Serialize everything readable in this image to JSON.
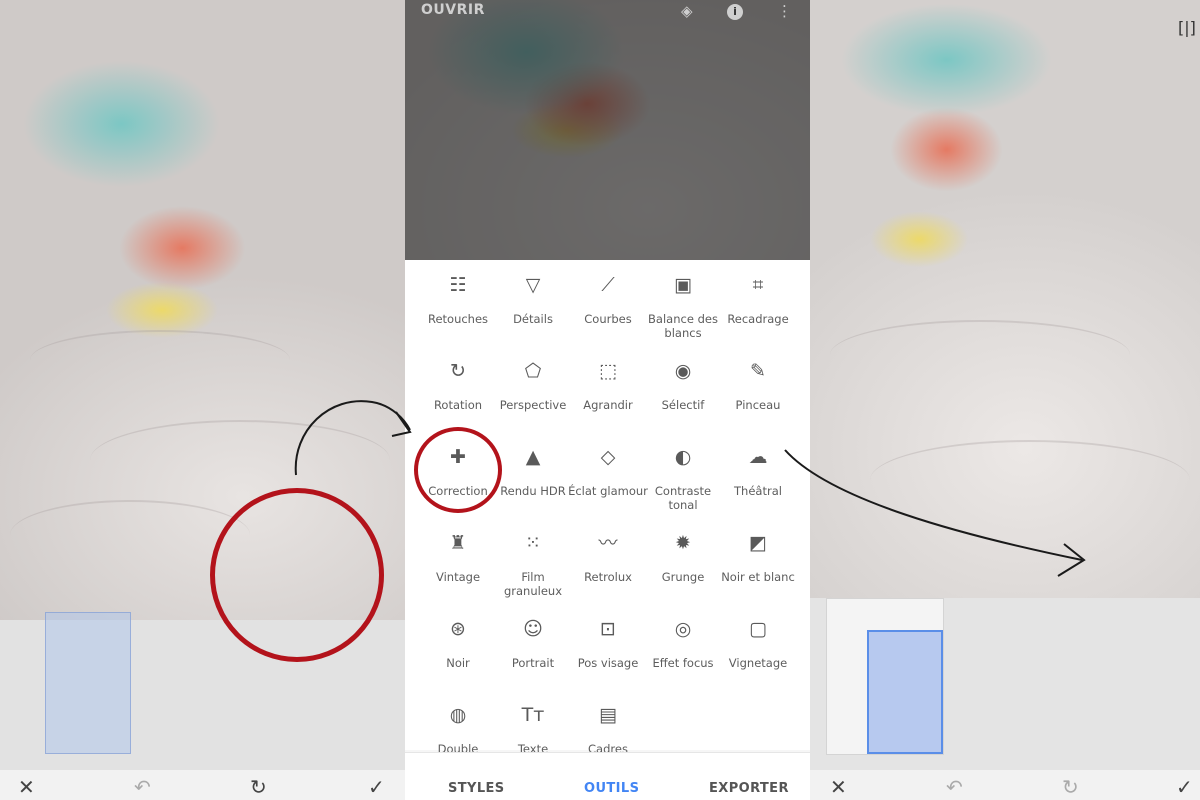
{
  "left_panel": {
    "bottom_bar": {
      "cancel": "✕",
      "undo": "↶",
      "redo": "↻",
      "apply": "✓"
    }
  },
  "editor": {
    "header": {
      "open_label": "OUVRIR",
      "layers_icon": "layers-icon",
      "info_icon": "i",
      "menu_icon": "⋮"
    },
    "tools": [
      {
        "label": "Retouches",
        "icon": "sliders-icon",
        "glyph": "☷"
      },
      {
        "label": "Détails",
        "icon": "triangle-down-icon",
        "glyph": "▽"
      },
      {
        "label": "Courbes",
        "icon": "curves-icon",
        "glyph": "⟋"
      },
      {
        "label": "Balance des blancs",
        "icon": "white-balance-icon",
        "glyph": "▣"
      },
      {
        "label": "Recadrage",
        "icon": "crop-icon",
        "glyph": "⌗"
      },
      {
        "label": "Rotation",
        "icon": "rotate-icon",
        "glyph": "↻"
      },
      {
        "label": "Perspective",
        "icon": "perspective-icon",
        "glyph": "⬠"
      },
      {
        "label": "Agrandir",
        "icon": "expand-icon",
        "glyph": "⬚"
      },
      {
        "label": "Sélectif",
        "icon": "selective-icon",
        "glyph": "◉"
      },
      {
        "label": "Pinceau",
        "icon": "brush-icon",
        "glyph": "✎"
      },
      {
        "label": "Correction",
        "icon": "healing-bandage-icon",
        "glyph": "✚"
      },
      {
        "label": "Rendu HDR",
        "icon": "mountains-icon",
        "glyph": "▲"
      },
      {
        "label": "Éclat glamour",
        "icon": "diamond-icon",
        "glyph": "◇"
      },
      {
        "label": "Contraste tonal",
        "icon": "tonal-contrast-icon",
        "glyph": "◐"
      },
      {
        "label": "Théâtral",
        "icon": "cloud-icon",
        "glyph": "☁"
      },
      {
        "label": "Vintage",
        "icon": "lamp-icon",
        "glyph": "♜"
      },
      {
        "label": "Film granuleux",
        "icon": "grain-icon",
        "glyph": "⁙"
      },
      {
        "label": "Retrolux",
        "icon": "mustache-icon",
        "glyph": "〰"
      },
      {
        "label": "Grunge",
        "icon": "grunge-icon",
        "glyph": "✹"
      },
      {
        "label": "Noir et blanc",
        "icon": "black-white-icon",
        "glyph": "◩"
      },
      {
        "label": "Noir",
        "icon": "film-reel-icon",
        "glyph": "⊛"
      },
      {
        "label": "Portrait",
        "icon": "face-icon",
        "glyph": "☺"
      },
      {
        "label": "Pos visage",
        "icon": "face-frame-icon",
        "glyph": "⊡"
      },
      {
        "label": "Effet focus",
        "icon": "focus-icon",
        "glyph": "◎"
      },
      {
        "label": "Vignetage",
        "icon": "vignette-icon",
        "glyph": "▢"
      },
      {
        "label": "Double exposition",
        "icon": "double-exposure-icon",
        "glyph": "◍"
      },
      {
        "label": "Texte",
        "icon": "text-icon",
        "glyph": "Tт"
      },
      {
        "label": "Cadres",
        "icon": "frame-icon",
        "glyph": "▤"
      }
    ],
    "tabs": [
      {
        "label": "STYLES",
        "active": false
      },
      {
        "label": "OUTILS",
        "active": true
      },
      {
        "label": "EXPORTER",
        "active": false
      }
    ]
  },
  "right_panel": {
    "compare_icon": "[|]",
    "bottom_bar": {
      "cancel": "✕",
      "undo": "↶",
      "redo": "↻",
      "apply": "✓"
    }
  },
  "colors": {
    "accent": "#4285f4",
    "annotation": "#b3131b",
    "selection": "#5a8ee8"
  }
}
